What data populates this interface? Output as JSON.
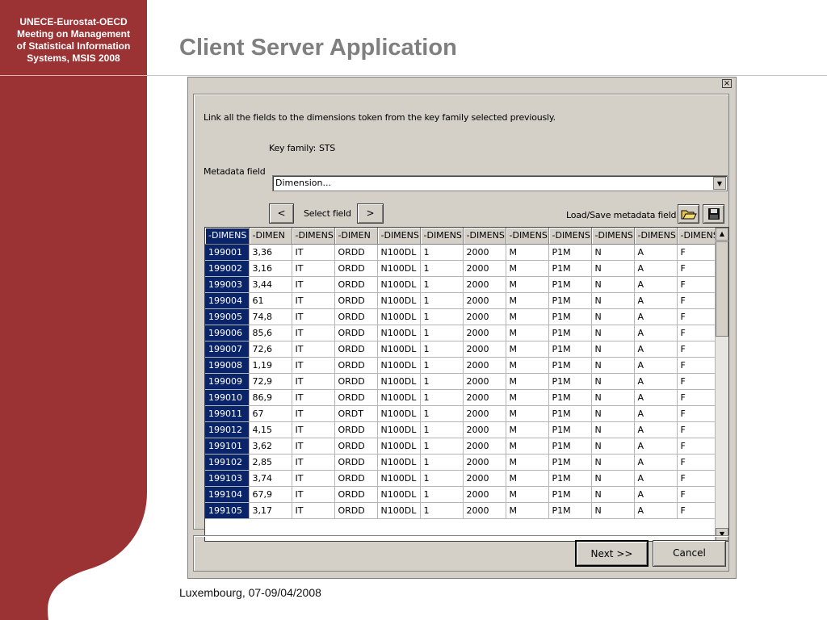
{
  "slide": {
    "conference": [
      "UNECE-Eurostat-OECD",
      "Meeting on Management",
      "of Statistical Information",
      "Systems, MSIS 2008"
    ],
    "title": "Client Server Application",
    "footer": "Luxembourg, 07-09/04/2008",
    "colors": {
      "sidebar": "#9b3334",
      "title": "#7f7f7f",
      "selection": "#0a246a"
    }
  },
  "dialog": {
    "close_label": "×",
    "instruction": "Link all the fields to the dimensions token from the key family selected previously.",
    "key_family_label": "Key family:",
    "key_family_value": "STS",
    "metadata_field_label": "Metadata field",
    "metadata_field_value": "Dimension...",
    "prev_label": "<",
    "select_field_label": "Select field",
    "next_field_label": ">",
    "load_save_label": "Load/Save metadata field",
    "open_icon": "open-folder-icon",
    "save_icon": "floppy-disk-icon",
    "next_button": "Next >>",
    "cancel_button": "Cancel"
  },
  "grid": {
    "headers": [
      "-DIMENS",
      "-DIMEN",
      "-DIMENS",
      "-DIMEN",
      "-DIMENS",
      "-DIMENS",
      "-DIMENS",
      "-DIMENS",
      "-DIMENS",
      "-DIMENS",
      "-DIMENS",
      "-DIMENS"
    ],
    "rows": [
      [
        "199001",
        "3,36",
        "IT",
        "ORDD",
        "N100DL",
        "1",
        "2000",
        "M",
        "P1M",
        "N",
        "A",
        "F"
      ],
      [
        "199002",
        "3,16",
        "IT",
        "ORDD",
        "N100DL",
        "1",
        "2000",
        "M",
        "P1M",
        "N",
        "A",
        "F"
      ],
      [
        "199003",
        "3,44",
        "IT",
        "ORDD",
        "N100DL",
        "1",
        "2000",
        "M",
        "P1M",
        "N",
        "A",
        "F"
      ],
      [
        "199004",
        "61",
        "IT",
        "ORDD",
        "N100DL",
        "1",
        "2000",
        "M",
        "P1M",
        "N",
        "A",
        "F"
      ],
      [
        "199005",
        "74,8",
        "IT",
        "ORDD",
        "N100DL",
        "1",
        "2000",
        "M",
        "P1M",
        "N",
        "A",
        "F"
      ],
      [
        "199006",
        "85,6",
        "IT",
        "ORDD",
        "N100DL",
        "1",
        "2000",
        "M",
        "P1M",
        "N",
        "A",
        "F"
      ],
      [
        "199007",
        "72,6",
        "IT",
        "ORDD",
        "N100DL",
        "1",
        "2000",
        "M",
        "P1M",
        "N",
        "A",
        "F"
      ],
      [
        "199008",
        "1,19",
        "IT",
        "ORDD",
        "N100DL",
        "1",
        "2000",
        "M",
        "P1M",
        "N",
        "A",
        "F"
      ],
      [
        "199009",
        "72,9",
        "IT",
        "ORDD",
        "N100DL",
        "1",
        "2000",
        "M",
        "P1M",
        "N",
        "A",
        "F"
      ],
      [
        "199010",
        "86,9",
        "IT",
        "ORDD",
        "N100DL",
        "1",
        "2000",
        "M",
        "P1M",
        "N",
        "A",
        "F"
      ],
      [
        "199011",
        "67",
        "IT",
        "ORDT",
        "N100DL",
        "1",
        "2000",
        "M",
        "P1M",
        "N",
        "A",
        "F"
      ],
      [
        "199012",
        "4,15",
        "IT",
        "ORDD",
        "N100DL",
        "1",
        "2000",
        "M",
        "P1M",
        "N",
        "A",
        "F"
      ],
      [
        "199101",
        "3,62",
        "IT",
        "ORDD",
        "N100DL",
        "1",
        "2000",
        "M",
        "P1M",
        "N",
        "A",
        "F"
      ],
      [
        "199102",
        "2,85",
        "IT",
        "ORDD",
        "N100DL",
        "1",
        "2000",
        "M",
        "P1M",
        "N",
        "A",
        "F"
      ],
      [
        "199103",
        "3,74",
        "IT",
        "ORDD",
        "N100DL",
        "1",
        "2000",
        "M",
        "P1M",
        "N",
        "A",
        "F"
      ],
      [
        "199104",
        "67,9",
        "IT",
        "ORDD",
        "N100DL",
        "1",
        "2000",
        "M",
        "P1M",
        "N",
        "A",
        "F"
      ],
      [
        "199105",
        "3,17",
        "IT",
        "ORDD",
        "N100DL",
        "1",
        "2000",
        "M",
        "P1M",
        "N",
        "A",
        "F"
      ]
    ]
  }
}
